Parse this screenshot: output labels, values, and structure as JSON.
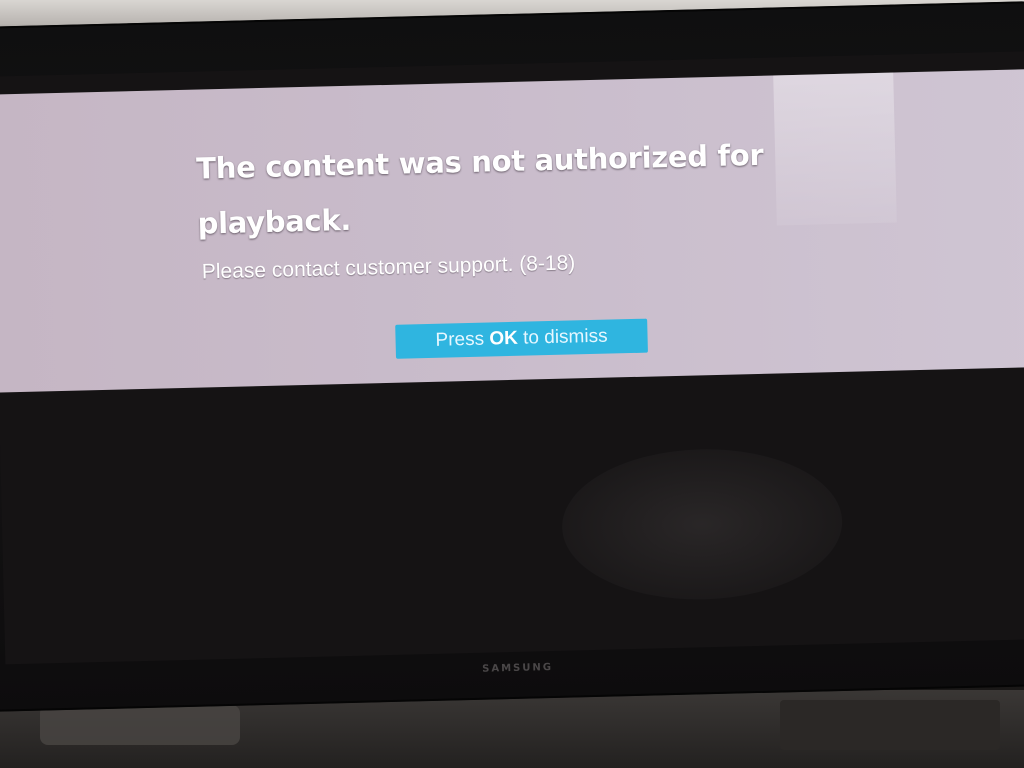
{
  "dialog": {
    "title": "The content was not authorized for playback.",
    "message": "Please contact customer support. (8-18)",
    "dismiss": {
      "prefix": "Press ",
      "key": "OK",
      "suffix": " to dismiss"
    }
  },
  "tv": {
    "brand": "SAMSUNG"
  },
  "colors": {
    "panel_background": "#c9bccb",
    "button_background": "#2fb5e0",
    "text": "#ffffff"
  }
}
